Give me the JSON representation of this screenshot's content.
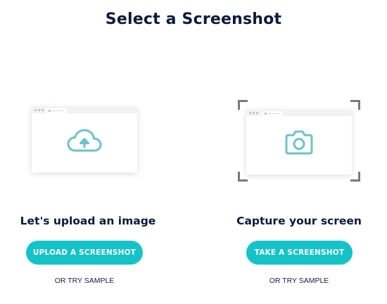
{
  "title": "Select a Screenshot",
  "upload": {
    "heading": "Let's upload an image",
    "button_label": "UPLOAD A SCREENSHOT",
    "sample_label": "OR TRY SAMPLE",
    "icon": "cloud-upload-icon"
  },
  "capture": {
    "heading": "Capture your screen",
    "button_label": "TAKE A SCREENSHOT",
    "sample_label": "OR TRY SAMPLE",
    "icon": "camera-icon"
  },
  "colors": {
    "accent": "#14c3c8",
    "icon": "#6cc3c9",
    "title": "#0e1a3a",
    "corner_marks": "#7a7a7a"
  }
}
